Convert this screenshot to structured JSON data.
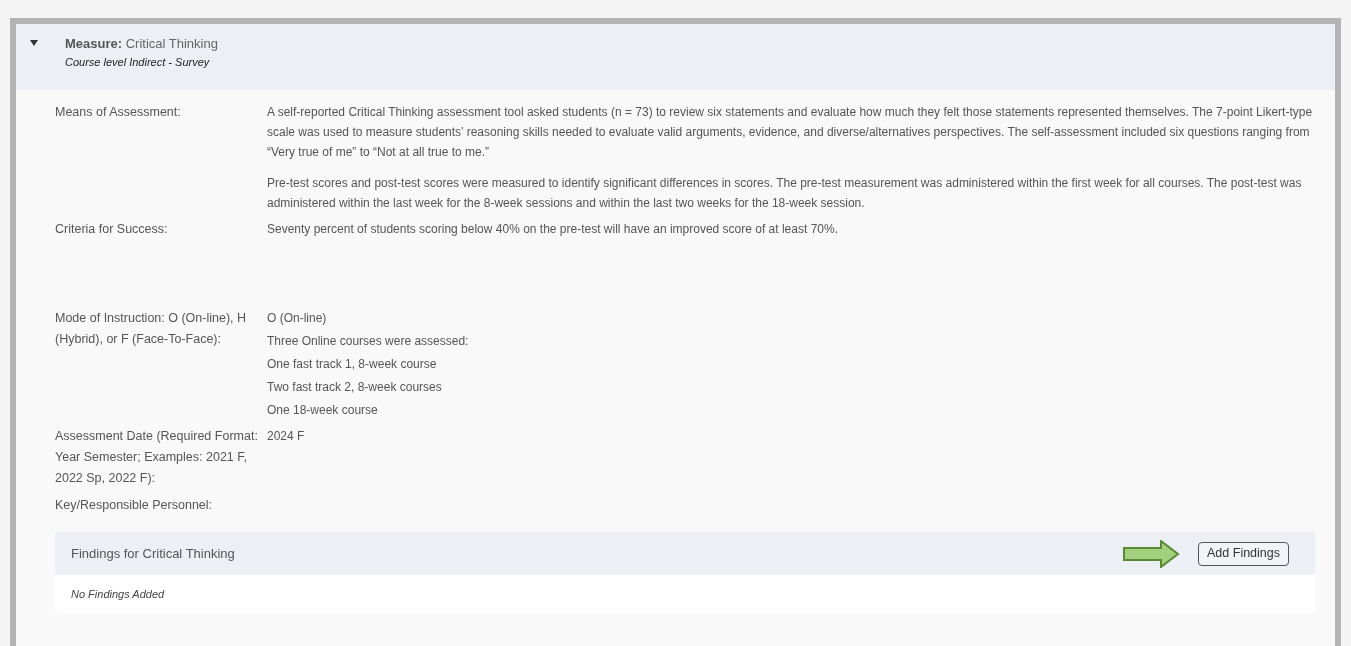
{
  "measure": {
    "expanded": true,
    "label": "Measure:",
    "title": "Critical Thinking",
    "subtitle": "Course level Indirect - Survey"
  },
  "fields": [
    {
      "label": "Means of Assessment:",
      "paragraphs": [
        "A self-reported Critical Thinking assessment tool asked students (n = 73) to review six statements and evaluate how much they felt those statements represented themselves. The 7-point Likert-type scale was used to measure students’ reasoning skills needed to evaluate valid arguments, evidence, and diverse/alternatives perspectives. The self-assessment included six questions ranging from “Very true of me” to “Not at all true to me.”",
        "Pre-test scores and post-test scores were measured to identify significant differences in scores. The pre-test measurement was administered within the first week for all courses. The post-test was administered within the last week for the 8-week sessions and within the last two weeks for the 18-week session."
      ]
    },
    {
      "label": "Criteria for Success:",
      "paragraphs": [
        "Seventy percent of students scoring below 40% on the pre-test will have an improved score of at least 70%."
      ]
    },
    {
      "label": "Mode of Instruction: O (On-line), H (Hybrid), or F (Face-To-Face):",
      "lines": [
        "O (On-line)",
        "Three Online courses were assessed:",
        "One fast track 1, 8-week course",
        "Two fast track 2, 8-week courses",
        "One 18-week course"
      ]
    },
    {
      "label": "Assessment Date (Required Format: Year Semester; Examples: 2021 F, 2022 Sp, 2022 F):",
      "lines": [
        "2024 F"
      ]
    },
    {
      "label": "Key/Responsible Personnel:"
    }
  ],
  "findings": {
    "title": "Findings for Critical Thinking",
    "button": "Add Findings",
    "empty": "No Findings Added"
  }
}
